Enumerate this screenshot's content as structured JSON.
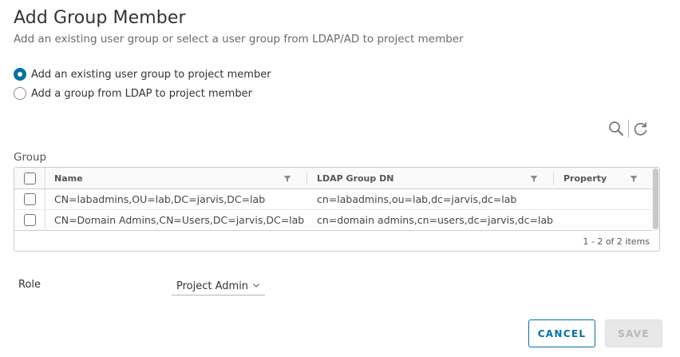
{
  "dialog": {
    "title": "Add Group Member",
    "subtitle": "Add an existing user group or select a user group from LDAP/AD to project member"
  },
  "options": [
    {
      "label": "Add an existing user group to project member",
      "selected": true
    },
    {
      "label": "Add a group from LDAP to project member",
      "selected": false
    }
  ],
  "toolbar": {
    "search_icon": "search-icon",
    "refresh_icon": "refresh-icon"
  },
  "group": {
    "label": "Group",
    "columns": [
      "Name",
      "LDAP Group DN",
      "Property"
    ],
    "rows": [
      {
        "name": "CN=labadmins,OU=lab,DC=jarvis,DC=lab",
        "dn": "cn=labadmins,ou=lab,dc=jarvis,dc=lab",
        "property": ""
      },
      {
        "name": "CN=Domain Admins,CN=Users,DC=jarvis,DC=lab",
        "dn": "cn=domain admins,cn=users,dc=jarvis,dc=lab",
        "property": ""
      }
    ],
    "footer": "1 - 2 of 2 items"
  },
  "role": {
    "label": "Role",
    "selected": "Project Admin"
  },
  "buttons": {
    "cancel": "CANCEL",
    "save": "SAVE"
  },
  "colors": {
    "accent": "#0072a3",
    "disabled": "#b8b8b8"
  }
}
